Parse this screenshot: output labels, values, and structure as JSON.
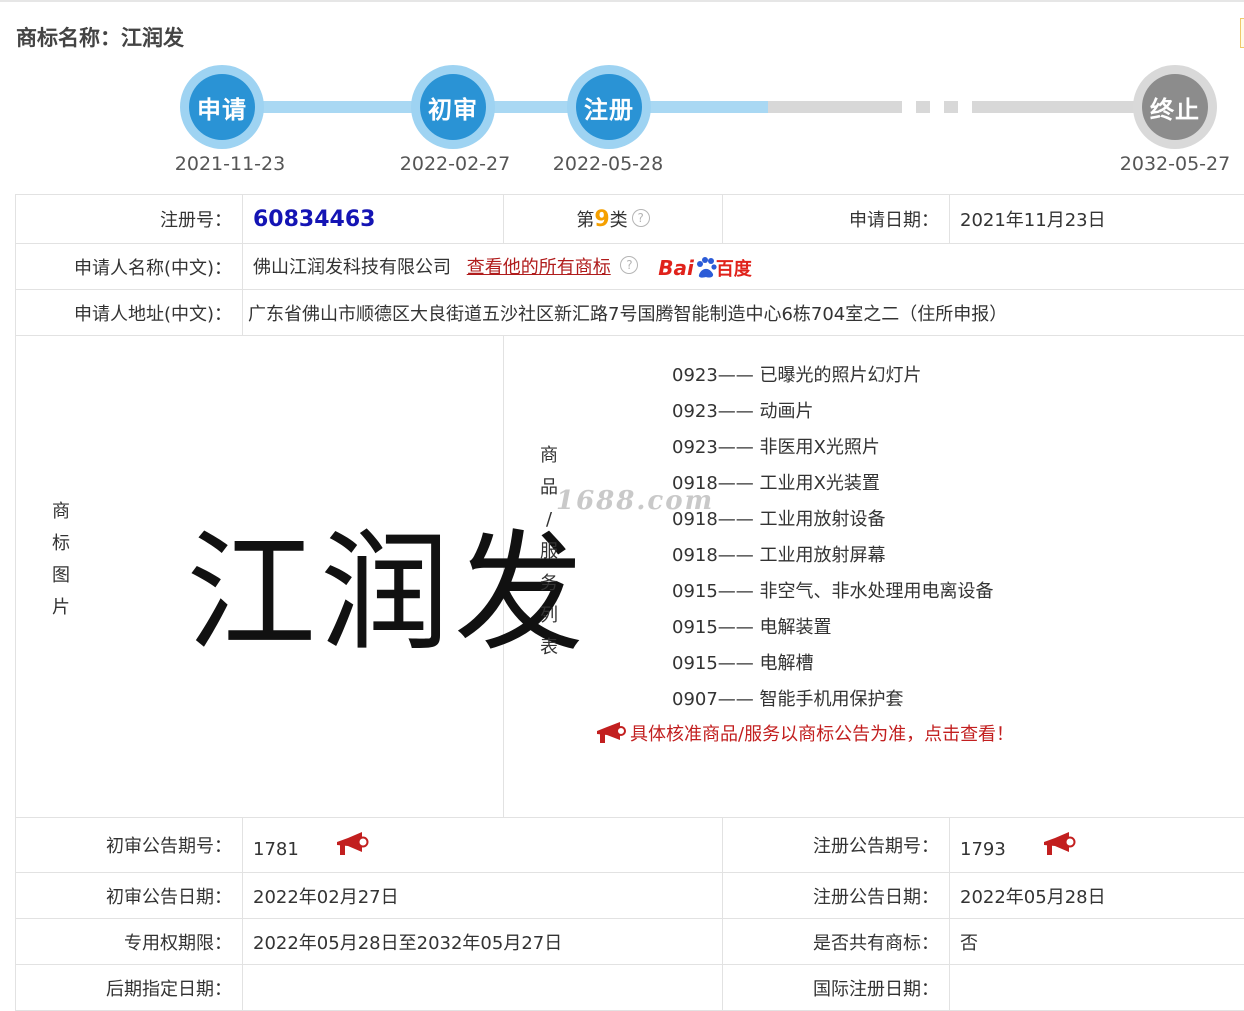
{
  "page": {
    "title": "商标名称：江润发"
  },
  "timeline": {
    "steps": [
      {
        "label": "申请",
        "date": "2021-11-23",
        "state": "done"
      },
      {
        "label": "初审",
        "date": "2022-02-27",
        "state": "done"
      },
      {
        "label": "注册",
        "date": "2022-05-28",
        "state": "done"
      },
      {
        "label": "终止",
        "date": "2032-05-27",
        "state": "future"
      }
    ]
  },
  "info": {
    "reg_no_label": "注册号：",
    "reg_no": "60834463",
    "class_prefix": "第",
    "class_num": "9",
    "class_suffix": "类",
    "help_glyph": "?",
    "apply_date_label": "申请日期：",
    "apply_date": "2021年11月23日",
    "applicant_name_label": "申请人名称(中文)：",
    "applicant_name": "佛山江润发科技有限公司",
    "all_marks_link": "查看他的所有商标",
    "baidu_bai": "Bai",
    "baidu_du": "百度",
    "applicant_addr_label": "申请人地址(中文)：",
    "applicant_addr": "广东省佛山市顺德区大良街道五沙社区新汇路7号国腾智能制造中心6栋704室之二（住所申报）",
    "mark_image_label": [
      "商",
      "标",
      "图",
      "片"
    ],
    "mark_text": "江润发",
    "watermark": "1688.com",
    "goods_label": [
      "商",
      "品",
      "/",
      "服",
      "务",
      "列",
      "表"
    ],
    "goods": [
      "0923—— 已曝光的照片幻灯片",
      "0923—— 动画片",
      "0923—— 非医用X光照片",
      "0918—— 工业用X光装置",
      "0918—— 工业用放射设备",
      "0918—— 工业用放射屏幕",
      "0915—— 非空气、非水处理用电离设备",
      "0915—— 电解装置",
      "0915—— 电解槽",
      "0907—— 智能手机用保护套"
    ],
    "goods_note": "具体核准商品/服务以商标公告为准，点击查看！",
    "prelim_issue_label": "初审公告期号：",
    "prelim_issue": "1781",
    "reg_issue_label": "注册公告期号：",
    "reg_issue": "1793",
    "prelim_date_label": "初审公告日期：",
    "prelim_date": "2022年02月27日",
    "reg_date_label": "注册公告日期：",
    "reg_date": "2022年05月28日",
    "exclusive_label": "专用权期限：",
    "exclusive": "2022年05月28日至2032年05月27日",
    "shared_label": "是否共有商标：",
    "shared": "否",
    "later_designation_label": "后期指定日期：",
    "later_designation": "",
    "intl_reg_label": "国际注册日期：",
    "intl_reg": ""
  },
  "colors": {
    "step_done": "#2a93d5",
    "step_future": "#8c8c8c",
    "link": "#b01c1c",
    "reg_no": "#1414b4",
    "class_num": "#f5a000"
  }
}
